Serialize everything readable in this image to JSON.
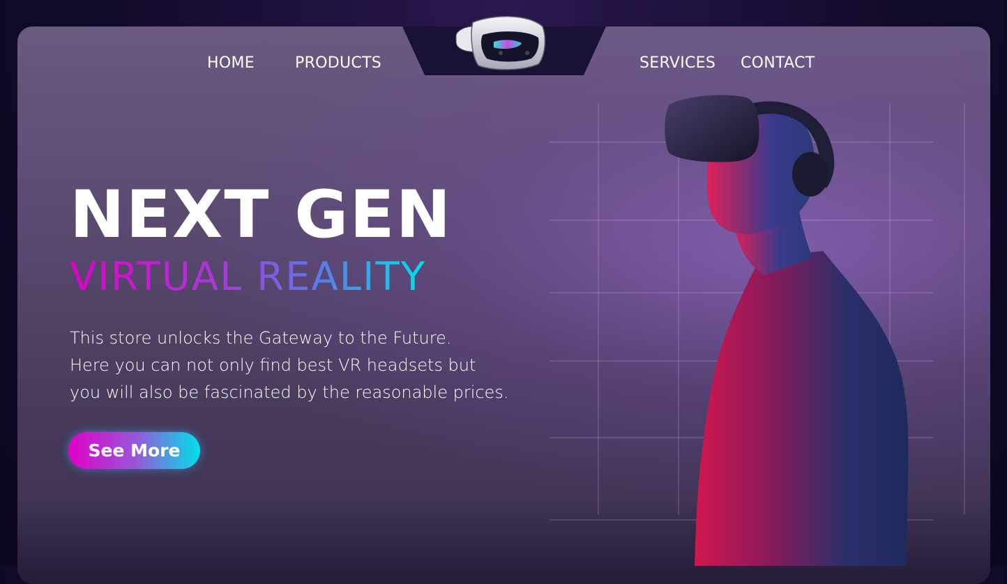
{
  "nav": {
    "links": [
      "HOME",
      "PRODUCTS",
      "SERVICES",
      "CONTACT"
    ]
  },
  "logo": {
    "icon": "vr-headset-icon"
  },
  "hero": {
    "headline": "NEXT GEN",
    "subheadline": "VIRTUAL REALITY",
    "description_lines": [
      "This store unlocks the Gateway to the Future.",
      "Here you can not only find best VR headsets but",
      "you will also be fascinated by the reasonable prices."
    ],
    "cta_label": "See More",
    "image": "man-wearing-vr-headset"
  },
  "colors": {
    "gradient_start": "#e000c8",
    "gradient_mid": "#5a7ae8",
    "gradient_end": "#00e2e8",
    "nav_notch": "#1a1236"
  }
}
